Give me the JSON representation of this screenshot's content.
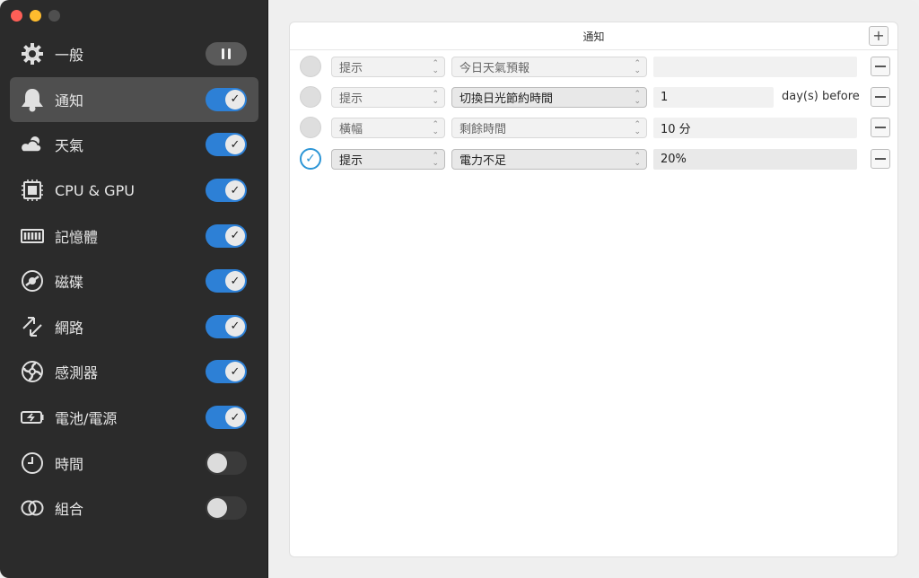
{
  "sidebar": {
    "items": [
      {
        "label": "一般",
        "icon": "gear-icon",
        "control": "pause"
      },
      {
        "label": "通知",
        "icon": "bell-icon",
        "control": "on",
        "active": true
      },
      {
        "label": "天氣",
        "icon": "weather-icon",
        "control": "on"
      },
      {
        "label": "CPU & GPU",
        "icon": "cpu-icon",
        "control": "on"
      },
      {
        "label": "記憶體",
        "icon": "memory-icon",
        "control": "on"
      },
      {
        "label": "磁碟",
        "icon": "disk-icon",
        "control": "on"
      },
      {
        "label": "網路",
        "icon": "network-icon",
        "control": "on"
      },
      {
        "label": "感測器",
        "icon": "fan-icon",
        "control": "on"
      },
      {
        "label": "電池/電源",
        "icon": "battery-icon",
        "control": "on"
      },
      {
        "label": "時間",
        "icon": "clock-icon",
        "control": "off"
      },
      {
        "label": "組合",
        "icon": "combo-icon",
        "control": "off"
      }
    ]
  },
  "panel": {
    "title": "通知",
    "add_label": "+",
    "rows": [
      {
        "type": "提示",
        "event": "今日天氣預報",
        "value": "",
        "suffix": "",
        "checked": false,
        "strong": false
      },
      {
        "type": "提示",
        "event": "切換日光節約時間",
        "value": "1",
        "suffix": "day(s) before",
        "checked": false,
        "strong": true
      },
      {
        "type": "橫幅",
        "event": "剩餘時間",
        "value": "10 分",
        "suffix": "",
        "checked": false,
        "strong": false
      },
      {
        "type": "提示",
        "event": "電力不足",
        "value": "20%",
        "suffix": "",
        "checked": true,
        "strong": true
      }
    ]
  },
  "colors": {
    "accent": "#2d80d6",
    "sidebar_bg": "#2b2b2b"
  }
}
